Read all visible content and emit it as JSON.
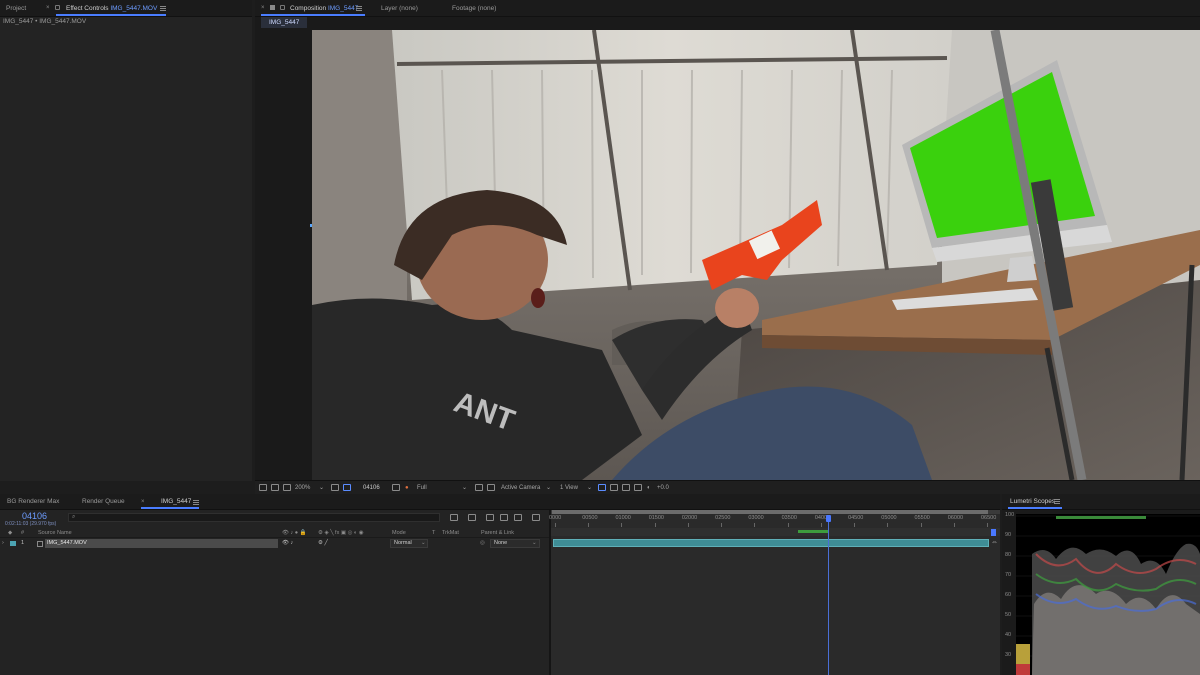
{
  "effect_panel": {
    "tab_project": "Project",
    "tab_effect_prefix": "Effect Controls",
    "tab_effect_file": "IMG_5447.MOV",
    "subtitle": "IMG_5447 • IMG_5447.MOV"
  },
  "comp_panel": {
    "tab_comp_prefix": "Composition",
    "tab_comp_name": "IMG_5447",
    "tab_layer": "Layer (none)",
    "tab_footage": "Footage (none)",
    "sub_tab": "IMG_5447"
  },
  "viewer_toolbar": {
    "zoom": "200%",
    "timecode": "04106",
    "resolution": "Full",
    "camera": "Active Camera",
    "views": "1 View",
    "exposure": "+0.0"
  },
  "bottom_tabs": {
    "bg_renderer": "BG Renderer Max",
    "render_queue": "Render Queue",
    "timeline_tab": "IMG_5447"
  },
  "timeline": {
    "current_frame": "04106",
    "sub_timecode": "0:02:11:03 (29.970 fps)",
    "columns": {
      "hash": "#",
      "source_name": "Source Name",
      "mode": "Mode",
      "t": "T",
      "trkmat": "TrkMat",
      "parent": "Parent & Link"
    },
    "layers": [
      {
        "number": "1",
        "name": "IMG_5447.MOV",
        "mode": "Normal",
        "parent": "None"
      }
    ],
    "ruler": [
      "0000",
      "00500",
      "01000",
      "01500",
      "02000",
      "02500",
      "03000",
      "03500",
      "04000",
      "04500",
      "05000",
      "05500",
      "06000",
      "06500"
    ],
    "playhead_fraction": 0.6317
  },
  "lumetri": {
    "title": "Lumetri Scopes",
    "scale": [
      "100",
      "90",
      "80",
      "70",
      "60",
      "50",
      "40",
      "30"
    ]
  }
}
